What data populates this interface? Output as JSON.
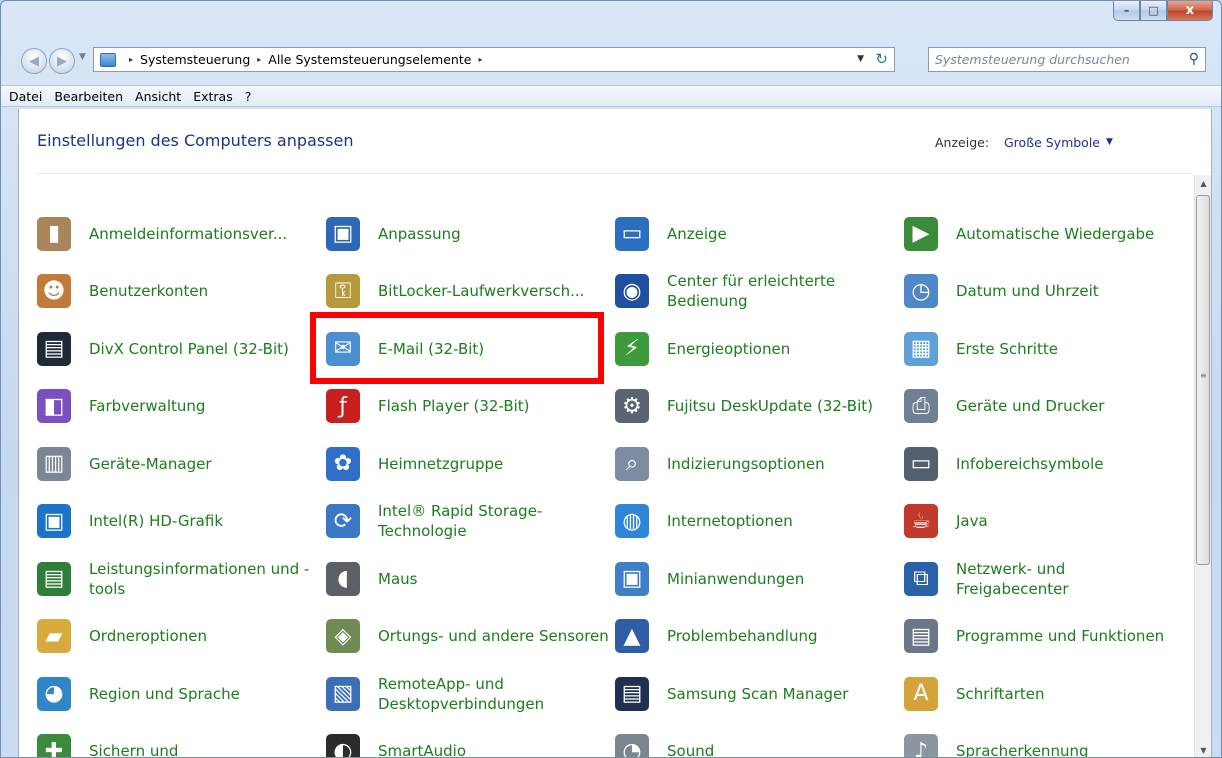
{
  "window": {
    "caption": {
      "min": "–",
      "max": "□",
      "close": "x"
    }
  },
  "address": {
    "crumbs": [
      "Systemsteuerung",
      "Alle Systemsteuerungselemente"
    ],
    "separator": "▸",
    "search_placeholder": "Systemsteuerung durchsuchen"
  },
  "menu": [
    "Datei",
    "Bearbeiten",
    "Ansicht",
    "Extras",
    "?"
  ],
  "header": {
    "title": "Einstellungen des Computers anpassen",
    "view_label": "Anzeige:",
    "view_value": "Große Symbole"
  },
  "items": [
    {
      "label": "Anmeldeinformationsver...",
      "icon": "vault-icon",
      "glyph": "▮",
      "color": "#a9865a"
    },
    {
      "label": "Anpassung",
      "icon": "desktop-personalize-icon",
      "glyph": "▣",
      "color": "#2f67b7"
    },
    {
      "label": "Anzeige",
      "icon": "monitor-icon",
      "glyph": "▭",
      "color": "#2b6fc0"
    },
    {
      "label": "Automatische Wiedergabe",
      "icon": "autoplay-icon",
      "glyph": "▶",
      "color": "#3a8c3a"
    },
    {
      "label": "Benutzerkonten",
      "icon": "users-icon",
      "glyph": "☻",
      "color": "#c07a3a"
    },
    {
      "label": "BitLocker-Laufwerkversch...",
      "icon": "bitlocker-key-icon",
      "glyph": "⚿",
      "color": "#b89a3c"
    },
    {
      "label": "Center für erleichterte Bedienung",
      "icon": "ease-of-access-icon",
      "glyph": "◉",
      "color": "#1f4f9e"
    },
    {
      "label": "Datum und Uhrzeit",
      "icon": "calendar-clock-icon",
      "glyph": "◷",
      "color": "#4f87c8"
    },
    {
      "label": "DivX Control Panel (32-Bit)",
      "icon": "divx-icon",
      "glyph": "▤",
      "color": "#1f2a38"
    },
    {
      "label": "E-Mail (32-Bit)",
      "icon": "mail-icon",
      "glyph": "✉",
      "color": "#4a8fd0"
    },
    {
      "label": "Energieoptionen",
      "icon": "battery-icon",
      "glyph": "⚡",
      "color": "#3d9a3d"
    },
    {
      "label": "Erste Schritte",
      "icon": "getting-started-icon",
      "glyph": "▦",
      "color": "#5fa0d8"
    },
    {
      "label": "Farbverwaltung",
      "icon": "color-management-icon",
      "glyph": "◧",
      "color": "#7a4fc0"
    },
    {
      "label": "Flash Player (32-Bit)",
      "icon": "flash-icon",
      "glyph": "ƒ",
      "color": "#c8201e"
    },
    {
      "label": "Fujitsu DeskUpdate (32-Bit)",
      "icon": "gears-icon",
      "glyph": "⚙",
      "color": "#5b6470"
    },
    {
      "label": "Geräte und Drucker",
      "icon": "printer-icon",
      "glyph": "⎙",
      "color": "#6f7f94"
    },
    {
      "label": "Geräte-Manager",
      "icon": "device-manager-icon",
      "glyph": "▥",
      "color": "#7a8696"
    },
    {
      "label": "Heimnetzgruppe",
      "icon": "homegroup-icon",
      "glyph": "✿",
      "color": "#2f6fc9"
    },
    {
      "label": "Indizierungsoptionen",
      "icon": "search-index-icon",
      "glyph": "⌕",
      "color": "#7c8da3"
    },
    {
      "label": "Infobereichsymbole",
      "icon": "notification-area-icon",
      "glyph": "▭",
      "color": "#55606e"
    },
    {
      "label": "Intel(R) HD-Grafik",
      "icon": "intel-graphics-icon",
      "glyph": "▣",
      "color": "#1d73c8"
    },
    {
      "label": "Intel® Rapid Storage-Technologie",
      "icon": "rapid-storage-icon",
      "glyph": "⟳",
      "color": "#3a78c6"
    },
    {
      "label": "Internetoptionen",
      "icon": "internet-options-icon",
      "glyph": "◍",
      "color": "#2f86d6"
    },
    {
      "label": "Java",
      "icon": "java-icon",
      "glyph": "☕",
      "color": "#c0392b"
    },
    {
      "label": "Leistungsinformationen und -tools",
      "icon": "performance-icon",
      "glyph": "▤",
      "color": "#2f7d3a"
    },
    {
      "label": "Maus",
      "icon": "mouse-icon",
      "glyph": "◖",
      "color": "#5c5f66"
    },
    {
      "label": "Minianwendungen",
      "icon": "gadgets-icon",
      "glyph": "▣",
      "color": "#3f7fc7"
    },
    {
      "label": "Netzwerk- und Freigabecenter",
      "icon": "network-icon",
      "glyph": "⧉",
      "color": "#2962a8"
    },
    {
      "label": "Ordneroptionen",
      "icon": "folder-options-icon",
      "glyph": "▰",
      "color": "#d8a93c"
    },
    {
      "label": "Ortungs- und andere Sensoren",
      "icon": "sensors-icon",
      "glyph": "◈",
      "color": "#6f8a55"
    },
    {
      "label": "Problembehandlung",
      "icon": "troubleshooting-icon",
      "glyph": "▲",
      "color": "#2f5ea6"
    },
    {
      "label": "Programme und Funktionen",
      "icon": "programs-icon",
      "glyph": "▤",
      "color": "#6a7788"
    },
    {
      "label": "Region und Sprache",
      "icon": "globe-clock-icon",
      "glyph": "◕",
      "color": "#2f86c9"
    },
    {
      "label": "RemoteApp- und Desktopverbindungen",
      "icon": "remoteapp-icon",
      "glyph": "▧",
      "color": "#3b6fb8"
    },
    {
      "label": "Samsung Scan Manager",
      "icon": "scanner-icon",
      "glyph": "▤",
      "color": "#1f3050"
    },
    {
      "label": "Schriftarten",
      "icon": "fonts-icon",
      "glyph": "A",
      "color": "#d6a23a"
    },
    {
      "label": "Sichern und",
      "icon": "backup-icon",
      "glyph": "✚",
      "color": "#3c8a3c"
    },
    {
      "label": "SmartAudio",
      "icon": "smartaudio-icon",
      "glyph": "◐",
      "color": "#2c2c2c"
    },
    {
      "label": "Sound",
      "icon": "speaker-icon",
      "glyph": "◔",
      "color": "#7d8591"
    },
    {
      "label": "Spracherkennung",
      "icon": "microphone-icon",
      "glyph": "♪",
      "color": "#8c96a3"
    }
  ]
}
